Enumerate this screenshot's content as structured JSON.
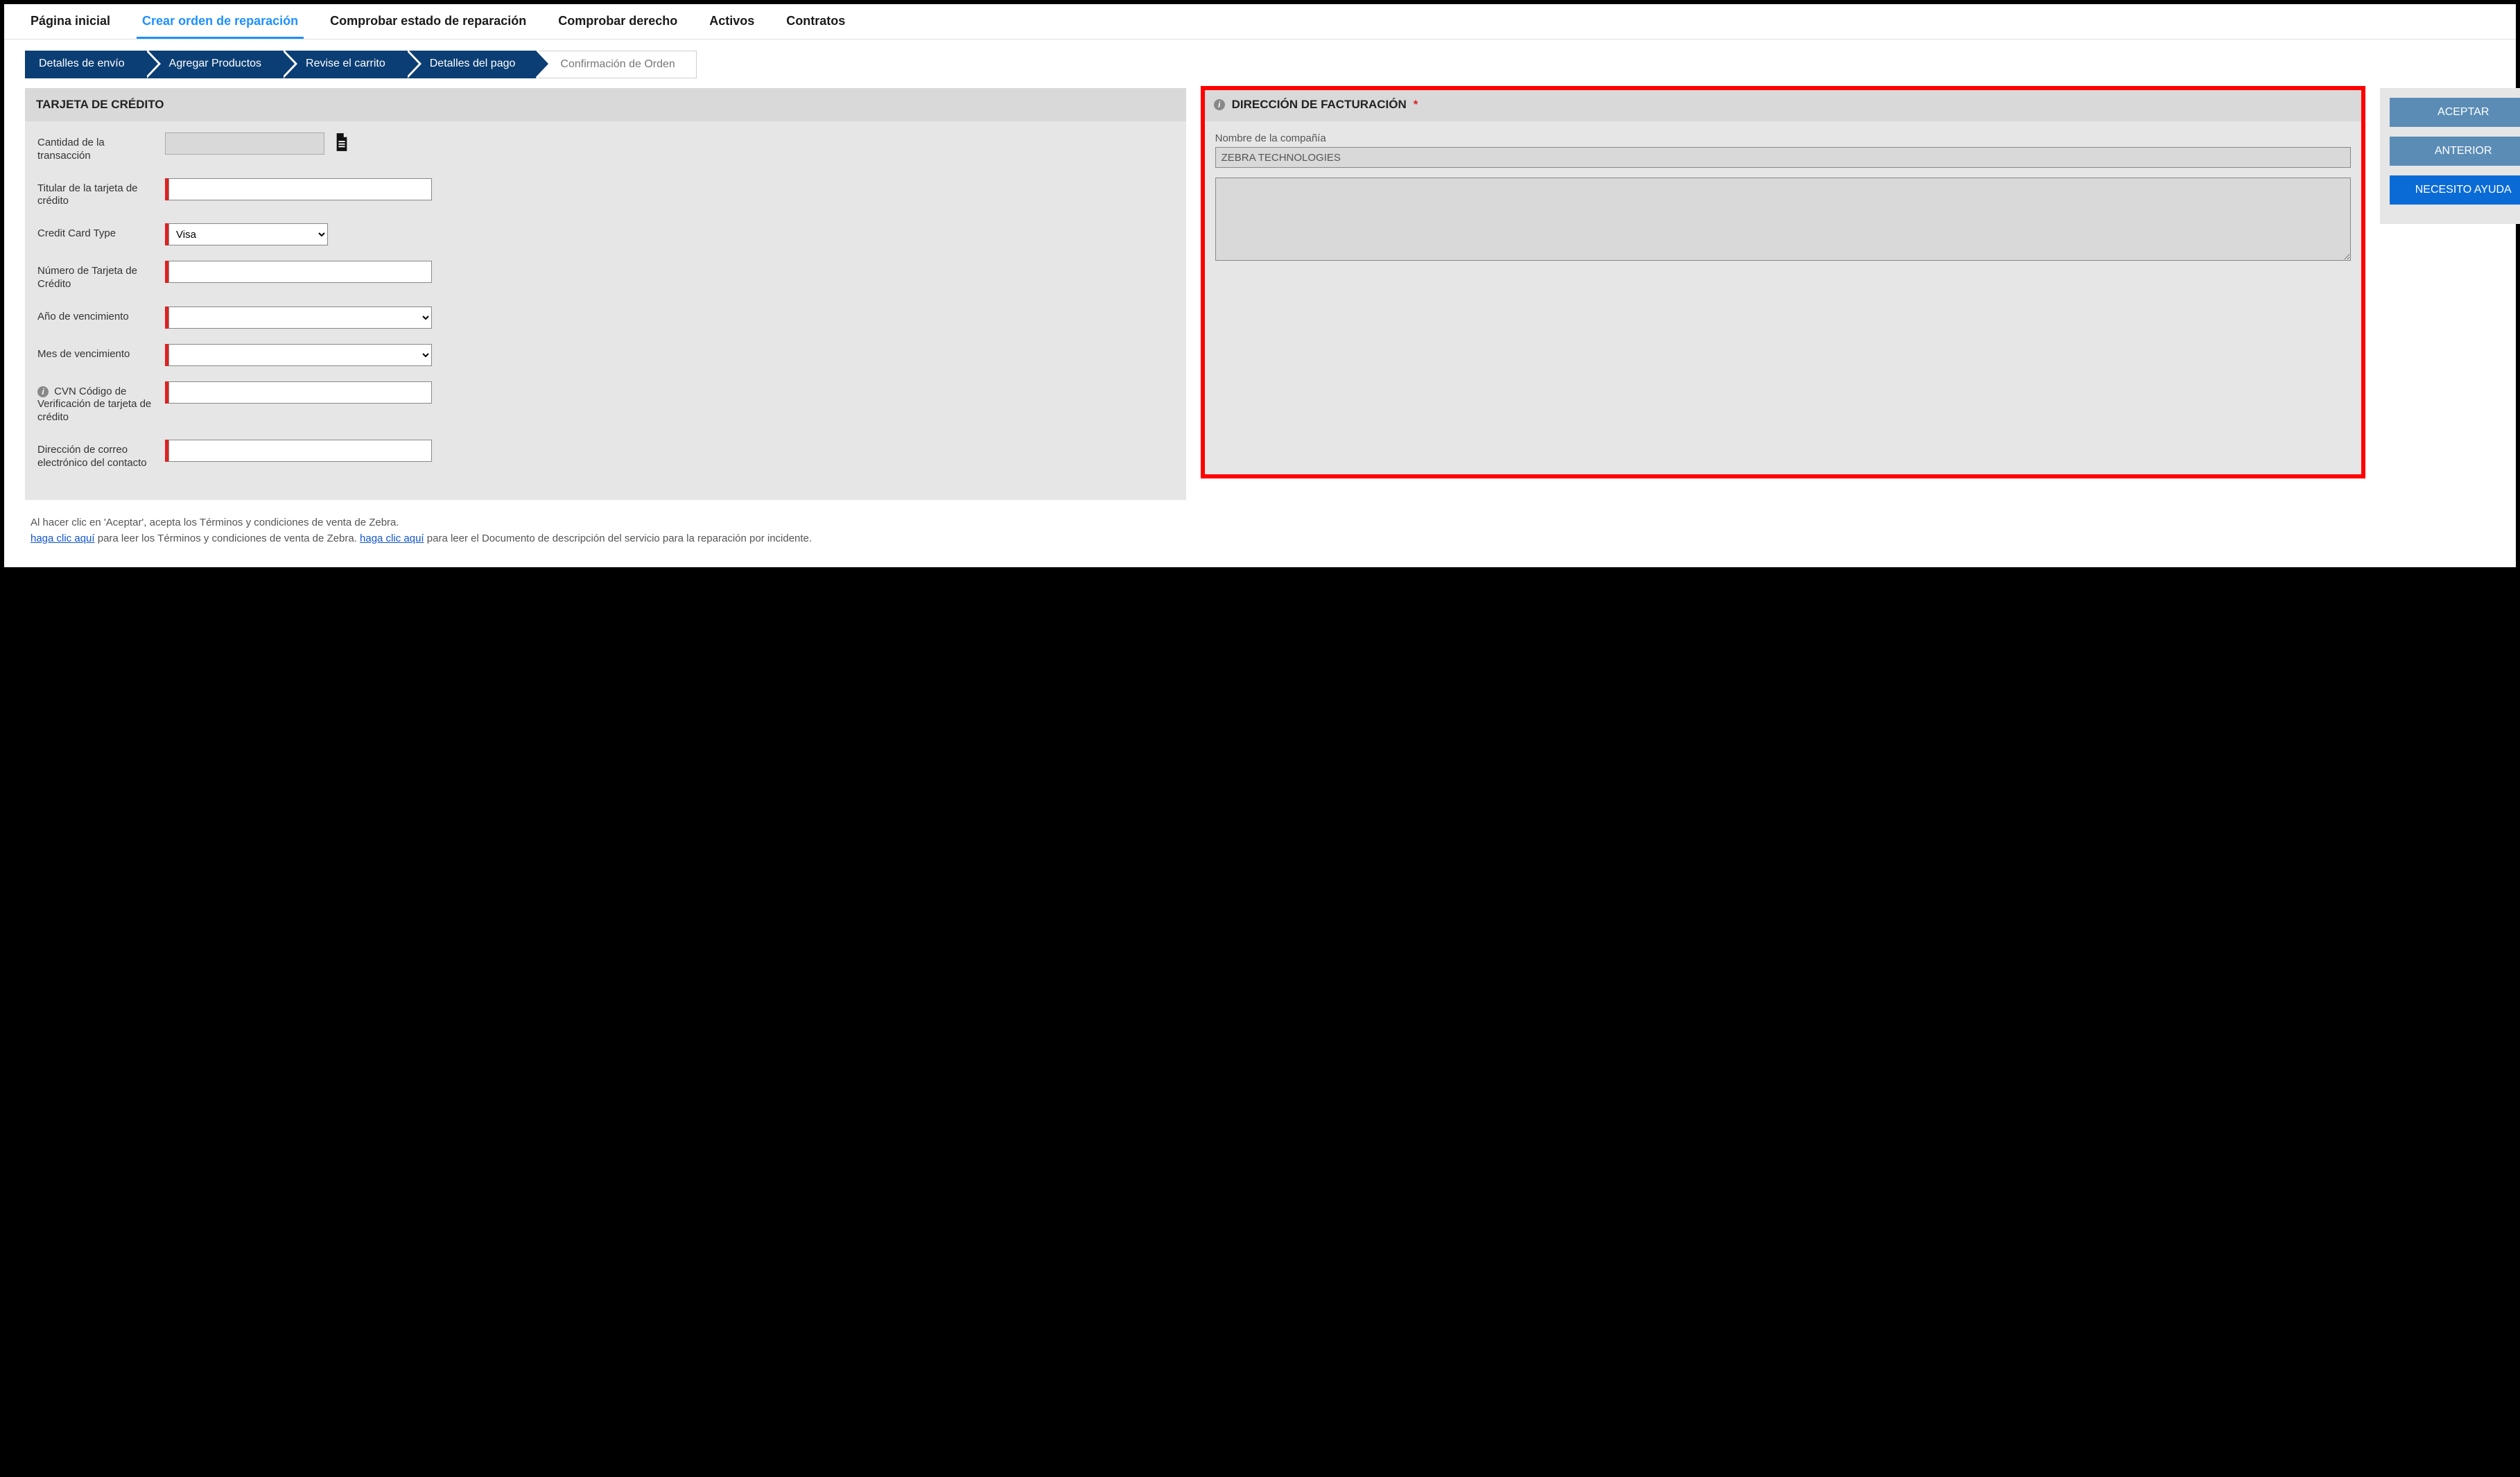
{
  "topnav": {
    "items": [
      {
        "label": "Página inicial"
      },
      {
        "label": "Crear orden de reparación"
      },
      {
        "label": "Comprobar estado de reparación"
      },
      {
        "label": "Comprobar derecho"
      },
      {
        "label": "Activos"
      },
      {
        "label": "Contratos"
      }
    ],
    "active_index": 1
  },
  "steps": {
    "items": [
      {
        "label": "Detalles de envío"
      },
      {
        "label": "Agregar Productos"
      },
      {
        "label": "Revise el carrito"
      },
      {
        "label": "Detalles del pago"
      },
      {
        "label": "Confirmación de Orden"
      }
    ],
    "inactive_index": 4
  },
  "credit_card": {
    "header": "TARJETA DE CRÉDITO",
    "fields": {
      "amount_label": "Cantidad de la transacción",
      "amount_value": "",
      "holder_label": "Titular de la tarjeta de crédito",
      "holder_value": "",
      "type_label": "Credit Card Type",
      "type_value": "Visa",
      "type_options": [
        "Visa"
      ],
      "number_label": "Número de Tarjeta de Crédito",
      "number_value": "",
      "year_label": "Año de vencimiento",
      "year_value": "",
      "month_label": "Mes de vencimiento",
      "month_value": "",
      "cvn_label": "CVN Código de Verificación de tarjeta de crédito",
      "cvn_value": "",
      "email_label": "Dirección de correo electrónico del contacto",
      "email_value": ""
    }
  },
  "billing": {
    "header": "DIRECCIÓN DE FACTURACIÓN",
    "company_label": "Nombre de la compañía",
    "company_value": "ZEBRA TECHNOLOGIES",
    "address_value": ""
  },
  "sidebar": {
    "accept": "ACEPTAR",
    "previous": "ANTERIOR",
    "help": "NECESITO AYUDA"
  },
  "terms": {
    "line1": "Al hacer clic en 'Aceptar', acepta los Términos y condiciones de venta de Zebra.",
    "link1": "haga clic aquí",
    "line2a": " para leer los Términos y condiciones de venta de Zebra. ",
    "link2": " haga clic aquí",
    "line2b": " para leer el Documento de descripción del servicio para la reparación por incidente."
  }
}
